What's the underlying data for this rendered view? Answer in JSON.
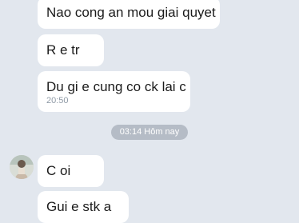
{
  "messages": [
    {
      "text": "Nao cong an mou giai quyet"
    },
    {
      "text": "R e tr"
    },
    {
      "text": "Du gi e cung co ck lai c",
      "time": "20:50"
    },
    {
      "text": "C oi"
    },
    {
      "text": "Gui e stk a"
    }
  ],
  "date_separator": "03:14 Hôm nay",
  "colors": {
    "background": "#e2e7ee",
    "bubble": "#ffffff",
    "separator_pill": "#b5bcc6"
  }
}
